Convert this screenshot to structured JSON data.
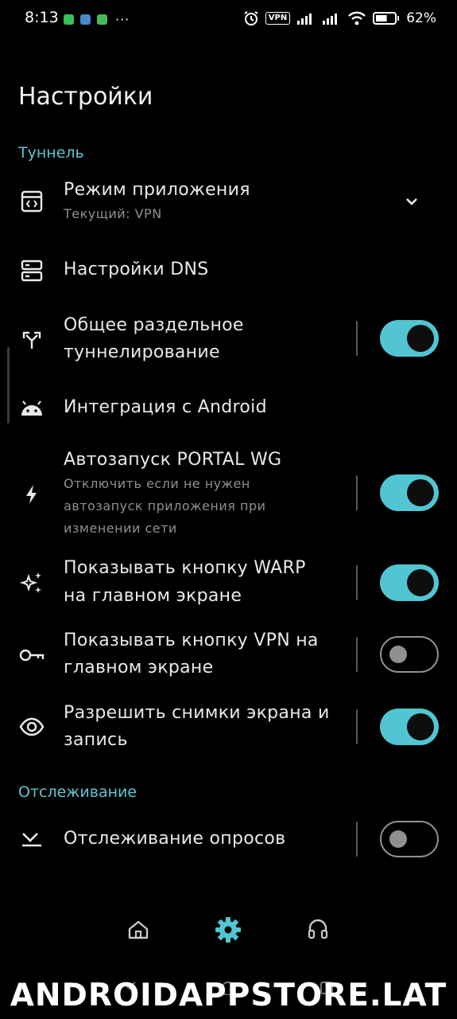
{
  "status_bar": {
    "time": "8:13",
    "vpn_badge": "VPN",
    "battery_percent": "62%",
    "battery_level": 0.62,
    "more_notifications": "···"
  },
  "title": "Настройки",
  "sections": {
    "tunnel": "Туннель",
    "tracking": "Отслеживание"
  },
  "items": {
    "app_mode": {
      "title": "Режим приложения",
      "subtitle": "Текущий: VPN"
    },
    "dns": {
      "title": "Настройки DNS"
    },
    "split_tunnel": {
      "title_line1": "Общее раздельное",
      "title_line2": "туннелирование",
      "enabled": true
    },
    "android_integration": {
      "title": "Интеграция с Android"
    },
    "autostart": {
      "title": "Автозапуск PORTAL WG",
      "subtitle_line1": "Отключить если не нужен",
      "subtitle_line2": "автозапуск приложения при",
      "subtitle_line3": "изменении сети",
      "enabled": true
    },
    "warp_button": {
      "title_line1": "Показывать кнопку WARP",
      "title_line2": "на главном экране",
      "enabled": true
    },
    "vpn_button": {
      "title_line1": "Показывать кнопку VPN на",
      "title_line2": "главном экране",
      "enabled": false
    },
    "screenshots": {
      "title_line1": "Разрешить снимки экрана и",
      "title_line2": "запись",
      "enabled": true
    },
    "poll_tracking": {
      "title": "Отслеживание опросов",
      "enabled": false
    }
  },
  "bottom_nav": {
    "items": [
      "home-icon",
      "settings-icon",
      "support-headset-icon"
    ],
    "active": "settings-icon"
  },
  "colors": {
    "accent": "#52c5d2",
    "section_header": "#5fc4d2",
    "background": "#000000"
  },
  "watermark": "ANDROIDAPPSTORE.LAT"
}
